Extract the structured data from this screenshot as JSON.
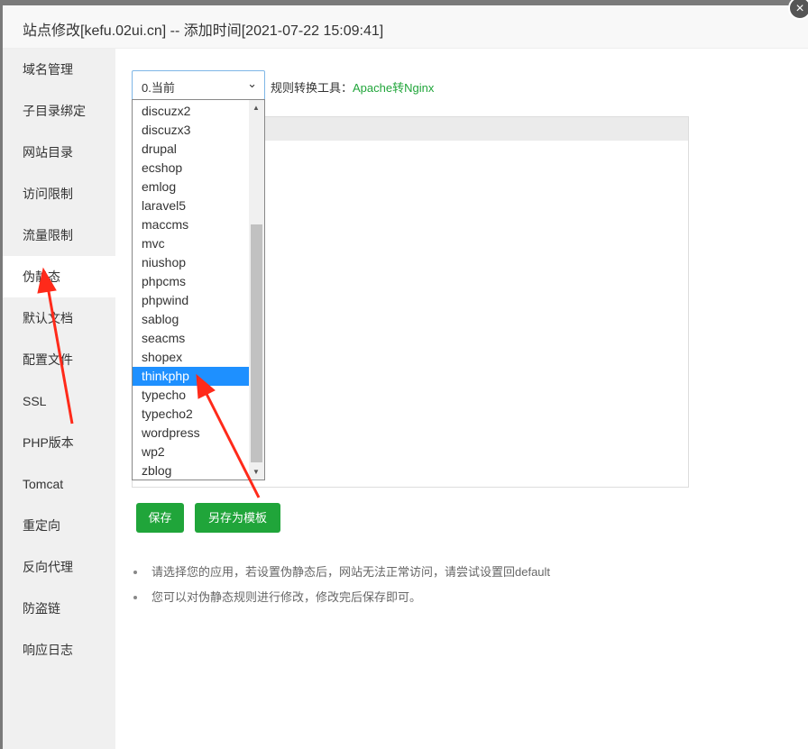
{
  "header": {
    "title": "站点修改[kefu.02ui.cn] -- 添加时间[2021-07-22 15:09:41]",
    "close": "×"
  },
  "sidebar": {
    "items": [
      {
        "label": "域名管理"
      },
      {
        "label": "子目录绑定"
      },
      {
        "label": "网站目录"
      },
      {
        "label": "访问限制"
      },
      {
        "label": "流量限制"
      },
      {
        "label": "伪静态",
        "active": true
      },
      {
        "label": "默认文档"
      },
      {
        "label": "配置文件"
      },
      {
        "label": "SSL"
      },
      {
        "label": "PHP版本"
      },
      {
        "label": "Tomcat"
      },
      {
        "label": "重定向"
      },
      {
        "label": "反向代理"
      },
      {
        "label": "防盗链"
      },
      {
        "label": "响应日志"
      }
    ]
  },
  "select": {
    "value": "0.当前",
    "chevron": "⌄"
  },
  "tool": {
    "label": "规则转换工具：",
    "link": "Apache转Nginx"
  },
  "dropdown": {
    "options": [
      "discuzx2",
      "discuzx3",
      "drupal",
      "ecshop",
      "emlog",
      "laravel5",
      "maccms",
      "mvc",
      "niushop",
      "phpcms",
      "phpwind",
      "sablog",
      "seacms",
      "shopex",
      "thinkphp",
      "typecho",
      "typecho2",
      "wordpress",
      "wp2",
      "zblog"
    ],
    "selected": "thinkphp"
  },
  "buttons": {
    "save": "保存",
    "save_template": "另存为模板"
  },
  "tips": [
    "请选择您的应用，若设置伪静态后，网站无法正常访问，请尝试设置回default",
    "您可以对伪静态规则进行修改，修改完后保存即可。"
  ],
  "colors": {
    "accent": "#20a53a",
    "selection": "#1e90ff",
    "annotation": "#ff2a1a"
  }
}
